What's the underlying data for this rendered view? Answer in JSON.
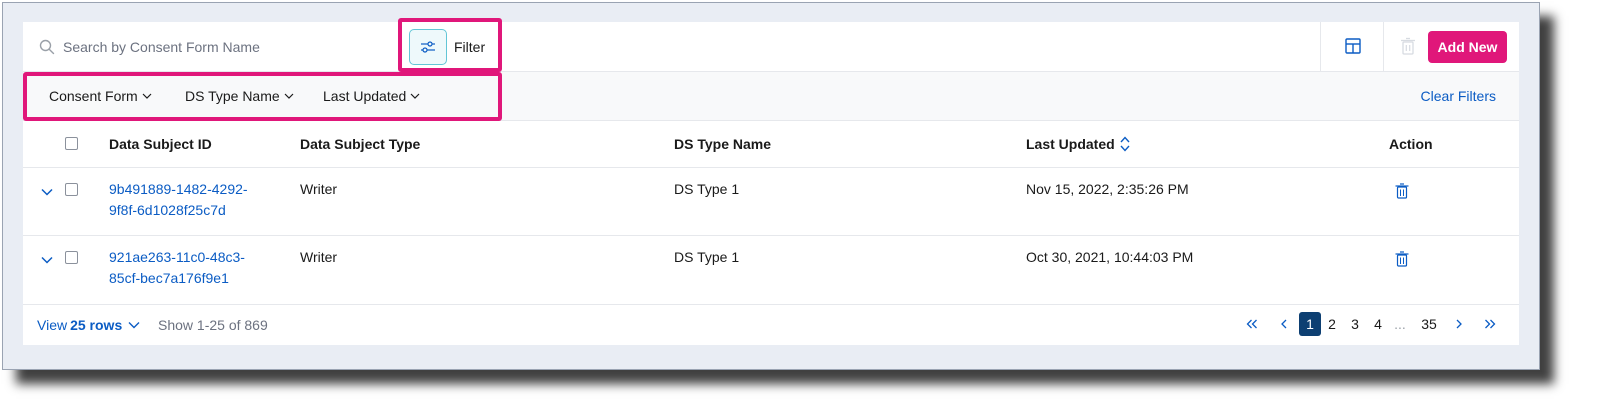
{
  "toolbar": {
    "search_placeholder": "Search by Consent Form Name",
    "filter_label": "Filter",
    "add_new_label": "Add New"
  },
  "filters": {
    "dropdowns": [
      "Consent Form",
      "DS Type Name",
      "Last Updated"
    ],
    "clear_label": "Clear Filters"
  },
  "table": {
    "columns": [
      "Data Subject ID",
      "Data Subject Type",
      "DS Type Name",
      "Last Updated",
      "Action"
    ],
    "rows": [
      {
        "id_line1": "9b491889-1482-4292-",
        "id_line2": "9f8f-6d1028f25c7d",
        "type": "Writer",
        "ds_type_name": "DS Type 1",
        "last_updated": "Nov 15, 2022, 2:35:26 PM"
      },
      {
        "id_line1": "921ae263-11c0-48c3-",
        "id_line2": "85cf-bec7a176f9e1",
        "type": "Writer",
        "ds_type_name": "DS Type 1",
        "last_updated": "Oct 30, 2021, 10:44:03 PM"
      }
    ]
  },
  "footer": {
    "view_prefix": "View",
    "view_count": "25 rows",
    "show_text": "Show 1-25 of 869",
    "pages": [
      "1",
      "2",
      "3",
      "4"
    ],
    "ellipsis": "...",
    "last_page": "35"
  },
  "colors": {
    "accent": "#e0177a",
    "link": "#0b5cc4",
    "active_page": "#0d3f72"
  }
}
